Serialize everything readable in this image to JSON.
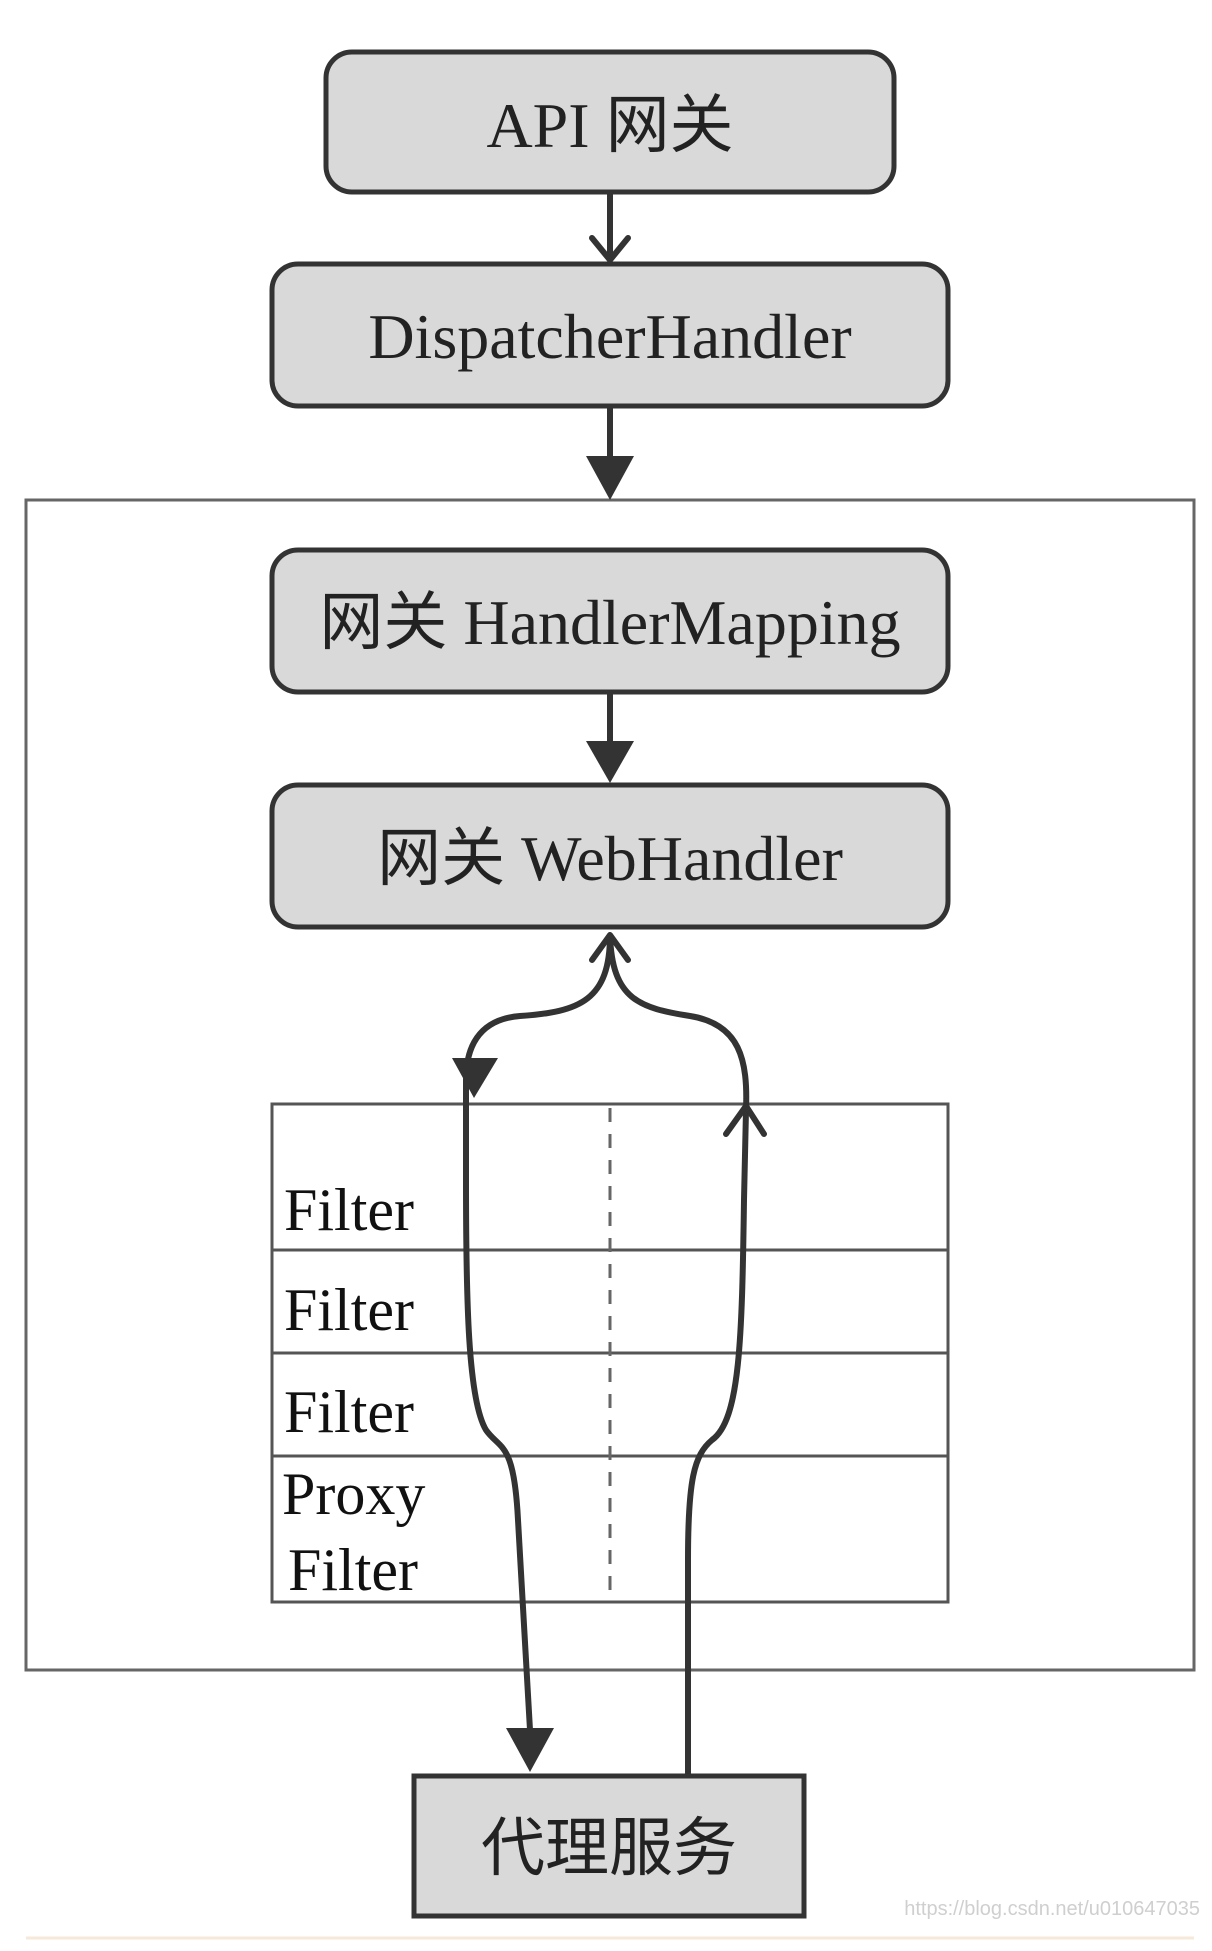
{
  "nodes": {
    "api_gateway": "API 网关",
    "dispatcher_handler": "DispatcherHandler",
    "gateway_handler_mapping": "网关 HandlerMapping",
    "gateway_web_handler": "网关 WebHandler",
    "proxy_service": "代理服务"
  },
  "filter_chain": {
    "rows": [
      [
        "Filter"
      ],
      [
        "Filter"
      ],
      [
        "Filter"
      ],
      [
        "Proxy",
        "Filter"
      ]
    ]
  },
  "watermark": "https://blog.csdn.net/u010647035",
  "colors": {
    "node_fill": "#d9d9d9",
    "node_stroke": "#333333",
    "container_stroke": "#666666",
    "arrow": "#333333"
  }
}
